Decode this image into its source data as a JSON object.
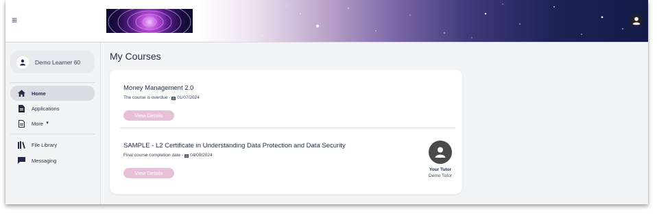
{
  "header": {
    "menu_icon": "hamburger-icon",
    "account_icon": "account-circle-icon",
    "accent_color": "#6a2c91"
  },
  "sidebar": {
    "user": {
      "name": "Demo Learner 60",
      "icon": "person-icon"
    },
    "items": [
      {
        "label": "Home",
        "icon": "home-icon",
        "active": true
      },
      {
        "label": "Applications",
        "icon": "document-icon",
        "active": false
      },
      {
        "label": "More",
        "icon": "file-icon",
        "active": false,
        "dropdown": true
      },
      {
        "label": "File Library",
        "icon": "library-icon",
        "active": false
      },
      {
        "label": "Messaging",
        "icon": "chat-icon",
        "active": false
      }
    ]
  },
  "main": {
    "title": "My Courses",
    "courses": [
      {
        "title": "Money Management 2.0",
        "status_text": "The course is overdue -",
        "date": "01/07/2024",
        "button": "View Details"
      },
      {
        "title": "SAMPLE - L2 Certificate in Understanding Data Protection and Data Security",
        "status_text": "Final course completion date -",
        "date": "04/09/2024",
        "button": "View Details"
      }
    ],
    "tutor": {
      "label": "Your Tutor",
      "name": "Demo Tutor"
    }
  }
}
